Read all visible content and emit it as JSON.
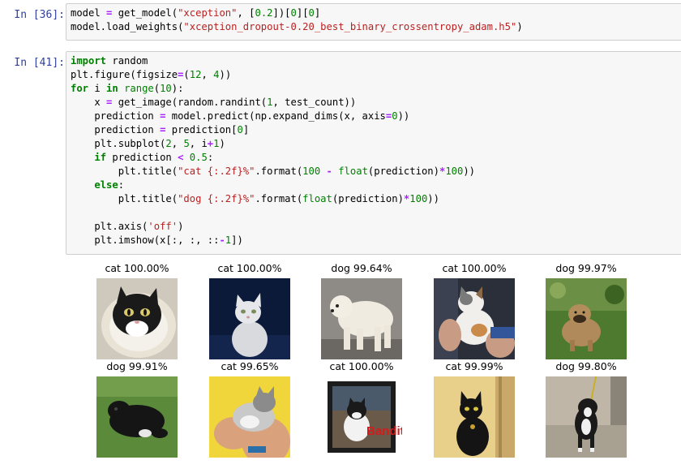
{
  "cells": [
    {
      "prompt": "In  [36]:",
      "lines": [
        "model = get_model(\"xception\", [0.2])[0][0]",
        "model.load_weights(\"xception_dropout-0.20_best_binary_crossentropy_adam.h5\")"
      ]
    },
    {
      "prompt": "In  [41]:",
      "lines": [
        "import random",
        "plt.figure(figsize=(12, 4))",
        "for i in range(10):",
        "    x = get_image(random.randint(1, test_count))",
        "    prediction = model.predict(np.expand_dims(x, axis=0))",
        "    prediction = prediction[0]",
        "    plt.subplot(2, 5, i+1)",
        "    if prediction < 0.5:",
        "        plt.title(\"cat {:.2f}%\".format(100 - float(prediction)*100))",
        "    else:",
        "        plt.title(\"dog {:.2f}%\".format(float(prediction)*100))",
        "",
        "    plt.axis('off')",
        "    plt.imshow(x[:, :, ::-1])"
      ]
    }
  ],
  "output": {
    "panels": [
      {
        "title": "cat 100.00%",
        "image": "black-white-cat-in-bowl"
      },
      {
        "title": "cat 100.00%",
        "image": "white-cat-on-blue"
      },
      {
        "title": "dog 99.64%",
        "image": "white-fluffy-dog"
      },
      {
        "title": "cat 100.00%",
        "image": "calico-kitten-held"
      },
      {
        "title": "dog 99.97%",
        "image": "pug-dog-on-grass"
      },
      {
        "title": "dog 99.91%",
        "image": "black-puppy-on-grass"
      },
      {
        "title": "cat 99.65%",
        "image": "grey-kitten-held"
      },
      {
        "title": "cat 100.00%",
        "image": "bandit-cat-framed"
      },
      {
        "title": "cat 99.99%",
        "image": "black-cat-yellow-wall"
      },
      {
        "title": "dog 99.80%",
        "image": "black-white-dog-standing"
      }
    ],
    "watermark_text": "Bandit"
  }
}
